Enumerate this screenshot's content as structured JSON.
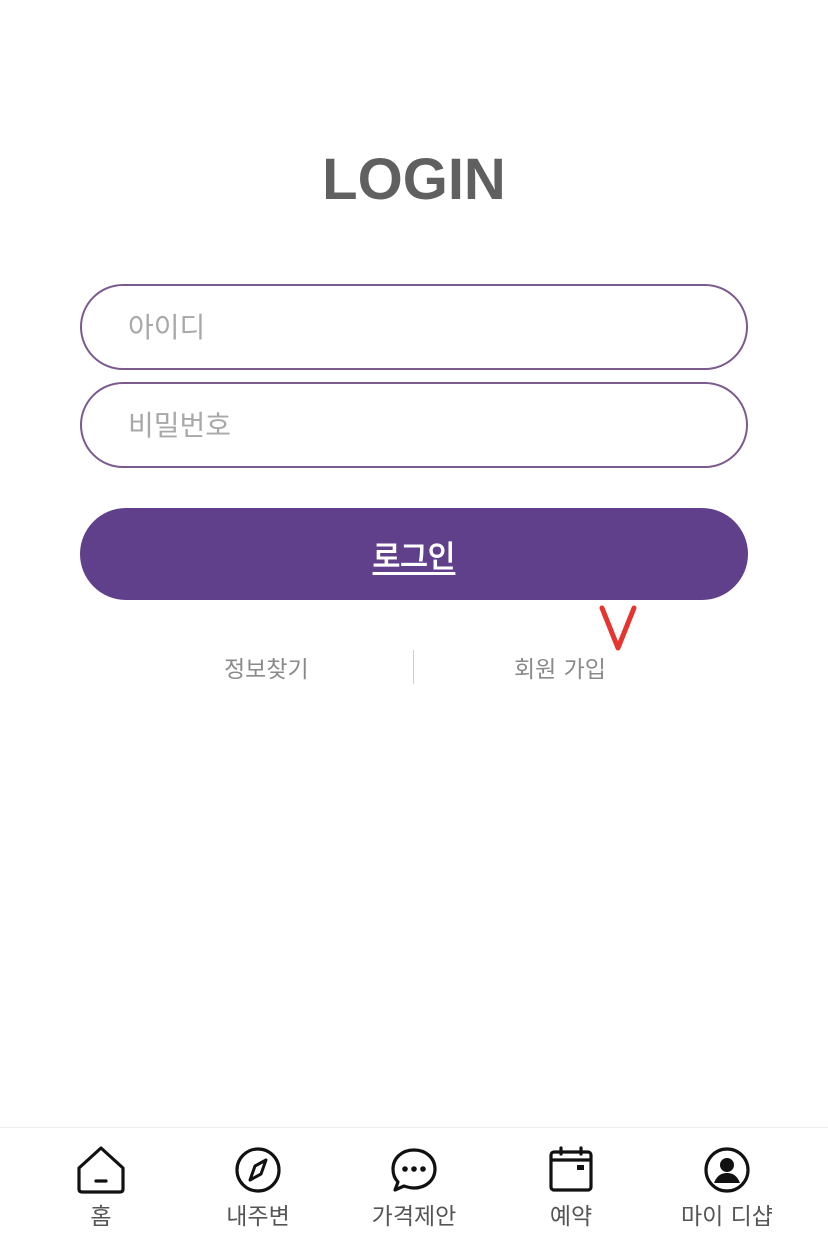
{
  "header": {
    "title": "LOGIN"
  },
  "form": {
    "id_placeholder": "아이디",
    "pw_placeholder": "비밀번호",
    "login_label": "로그인"
  },
  "links": {
    "find_info": "정보찾기",
    "signup": "회원 가입"
  },
  "annotation": {
    "mark": "V",
    "color": "#e8342e"
  },
  "tabbar": {
    "items": [
      {
        "label": "홈",
        "icon": "home-icon"
      },
      {
        "label": "내주변",
        "icon": "compass-icon"
      },
      {
        "label": "가격제안",
        "icon": "chat-bubble-icon"
      },
      {
        "label": "예약",
        "icon": "calendar-icon"
      },
      {
        "label": "마이 디샵",
        "icon": "profile-icon"
      }
    ]
  },
  "colors": {
    "accent": "#61408b",
    "field_border": "#7b5a8e",
    "title": "#606060",
    "link": "#8a8a8a"
  }
}
